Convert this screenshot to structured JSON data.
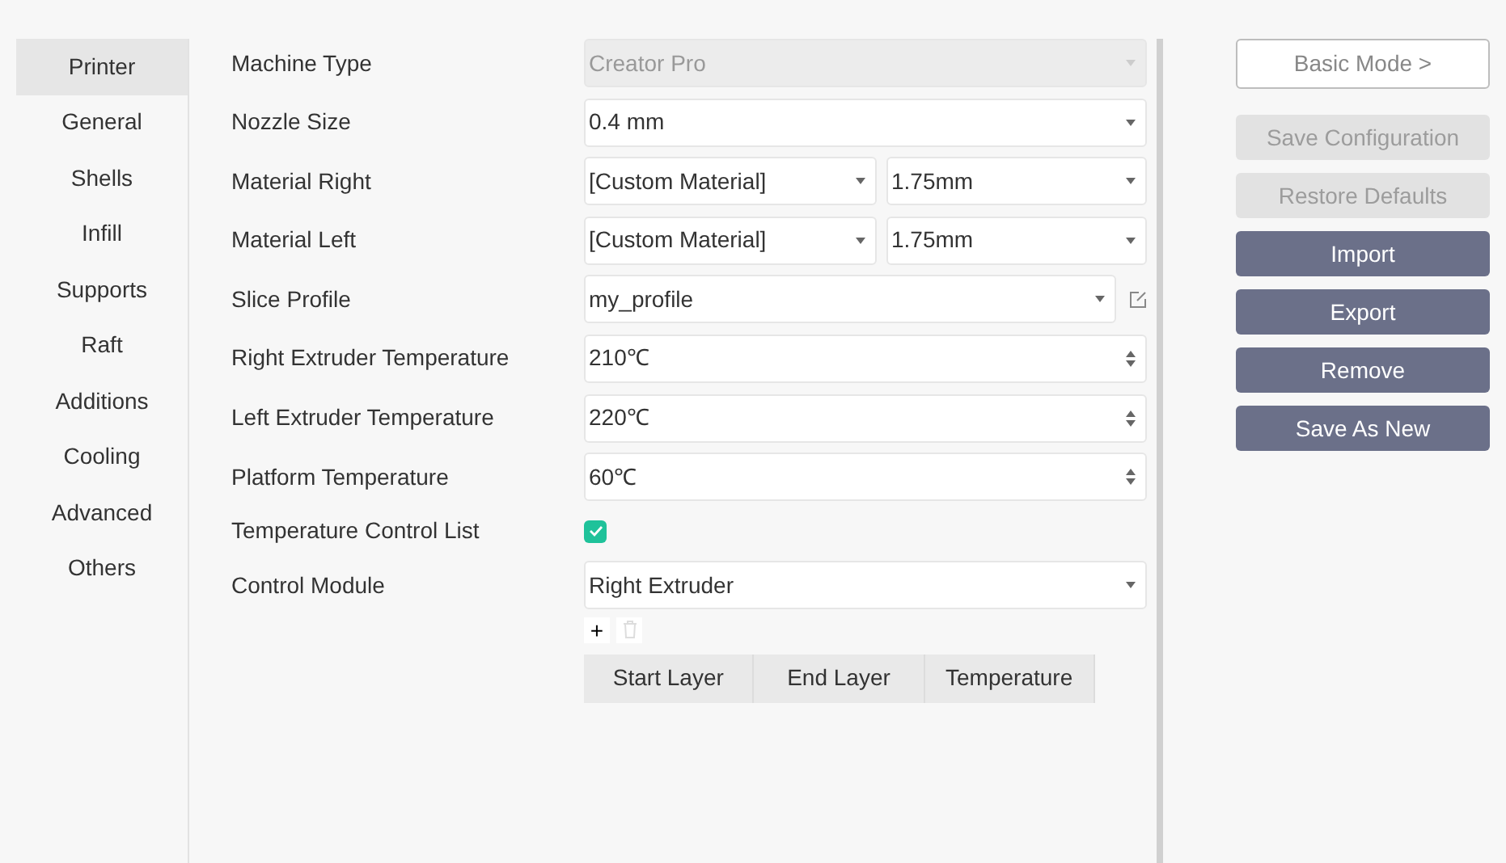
{
  "sidebar": {
    "items": [
      {
        "label": "Printer",
        "selected": true
      },
      {
        "label": "General",
        "selected": false
      },
      {
        "label": "Shells",
        "selected": false
      },
      {
        "label": "Infill",
        "selected": false
      },
      {
        "label": "Supports",
        "selected": false
      },
      {
        "label": "Raft",
        "selected": false
      },
      {
        "label": "Additions",
        "selected": false
      },
      {
        "label": "Cooling",
        "selected": false
      },
      {
        "label": "Advanced",
        "selected": false
      },
      {
        "label": "Others",
        "selected": false
      }
    ]
  },
  "settings": [
    {
      "label": "Machine Type",
      "kind": "select",
      "value": "Creator Pro",
      "disabled": true
    },
    {
      "label": "Nozzle Size",
      "kind": "select",
      "value": "0.4 mm",
      "disabled": false
    },
    {
      "label": "Material Right",
      "kind": "dual_select",
      "values": [
        "[Custom Material]",
        "1.75mm"
      ]
    },
    {
      "label": "Material Left",
      "kind": "dual_select",
      "values": [
        "[Custom Material]",
        "1.75mm"
      ]
    },
    {
      "label": "Slice Profile",
      "kind": "profile",
      "value": "my_profile"
    },
    {
      "label": "Right Extruder Temperature",
      "kind": "spin",
      "value": "210℃"
    },
    {
      "label": "Left Extruder Temperature",
      "kind": "spin",
      "value": "220℃"
    },
    {
      "label": "Platform Temperature",
      "kind": "spin",
      "value": "60℃"
    },
    {
      "label": "Temperature Control List",
      "kind": "checkbox",
      "checked": true
    },
    {
      "label": "Control Module",
      "kind": "select",
      "value": "Right Extruder",
      "disabled": false
    }
  ],
  "control_list": {
    "add": "+",
    "delete_disabled": true,
    "columns": [
      "Start Layer",
      "End Layer",
      "Temperature"
    ]
  },
  "buttons": [
    {
      "label": "Basic Mode >",
      "kind": "outline",
      "disabled": false
    },
    {
      "label": "Save Configuration",
      "kind": "solid",
      "disabled": true
    },
    {
      "label": "Restore Defaults",
      "kind": "solid",
      "disabled": true
    },
    {
      "label": "Import",
      "kind": "solid",
      "disabled": false
    },
    {
      "label": "Export",
      "kind": "solid",
      "disabled": false
    },
    {
      "label": "Remove",
      "kind": "solid",
      "disabled": false
    },
    {
      "label": "Save As New",
      "kind": "solid",
      "disabled": false
    }
  ]
}
